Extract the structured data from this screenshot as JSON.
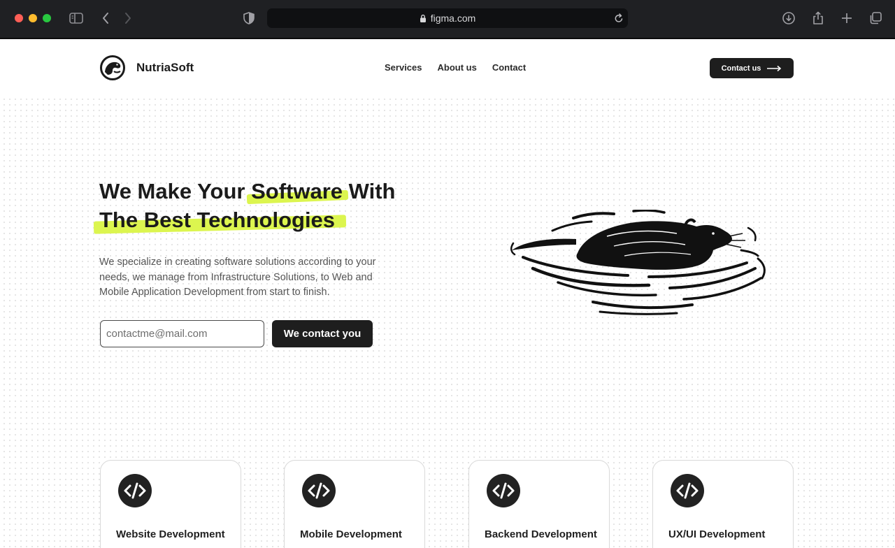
{
  "browser": {
    "url": "figma.com"
  },
  "nav": {
    "brand": "NutriaSoft",
    "links": [
      "Services",
      "About us",
      "Contact"
    ],
    "cta_label": "Contact us"
  },
  "hero": {
    "title_part1": "We Make Your ",
    "title_highlight1": "Software",
    "title_part2": " With",
    "title_highlight2": "The Best Technologies",
    "description": "We specialize in creating software solutions according to your needs, we manage from Infrastructure Solutions, to Web and Mobile Application Development from start to finish.",
    "email_placeholder": "contactme@mail.com",
    "submit_label": "We contact you"
  },
  "services": [
    {
      "title": "Website Development",
      "icon": "code-icon"
    },
    {
      "title": "Mobile Development",
      "icon": "code-icon"
    },
    {
      "title": "Backend Development",
      "icon": "code-icon"
    },
    {
      "title": "UX/UI Development",
      "icon": "code-icon"
    }
  ],
  "colors": {
    "accent": "#dcf54f",
    "dark": "#1e1e1e"
  }
}
